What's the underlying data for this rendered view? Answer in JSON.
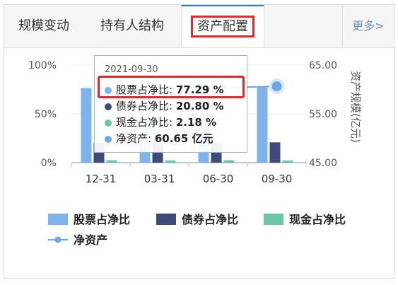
{
  "tabs": [
    {
      "label": "规模变动"
    },
    {
      "label": "持有人结构"
    },
    {
      "label": "资产配置"
    }
  ],
  "more_label": "更多>",
  "colors": {
    "stock": "#7db4ec",
    "bond": "#3d4a7a",
    "cash": "#6cc8a4",
    "net": "#6aa7e3",
    "accent": "#2f7bd6",
    "highlight": "#e8262b"
  },
  "tooltip": {
    "date": "2021-09-30",
    "rows": [
      {
        "label": "股票占净比:",
        "value": "77.29 %"
      },
      {
        "label": "债券占净比:",
        "value": "20.80 %"
      },
      {
        "label": "现金占净比:",
        "value": "2.18 %"
      },
      {
        "label": "净资产:",
        "value": "60.65 亿元"
      }
    ]
  },
  "chart_data": {
    "type": "bar",
    "categories": [
      "12-31",
      "03-31",
      "06-30",
      "09-30"
    ],
    "series": [
      {
        "name": "股票占净比",
        "values": [
          76.5,
          76.0,
          80.0,
          77.29
        ]
      },
      {
        "name": "债券占净比",
        "values": [
          20.0,
          20.0,
          20.0,
          20.8
        ]
      },
      {
        "name": "现金占净比",
        "values": [
          2.5,
          2.3,
          2.5,
          2.18
        ]
      },
      {
        "name": "净资产",
        "type": "line",
        "axis": "right",
        "values": [
          60.5,
          60.0,
          60.3,
          60.65
        ]
      }
    ],
    "yticks_left": [
      "100%",
      "50%",
      "0%"
    ],
    "yticks_right": [
      "65.00",
      "55.00",
      "45.00"
    ],
    "ylim_left": [
      0,
      100
    ],
    "ylim_right": [
      45,
      65
    ],
    "ylabel_right": "资产规模(亿元)",
    "legend_position": "bottom"
  }
}
